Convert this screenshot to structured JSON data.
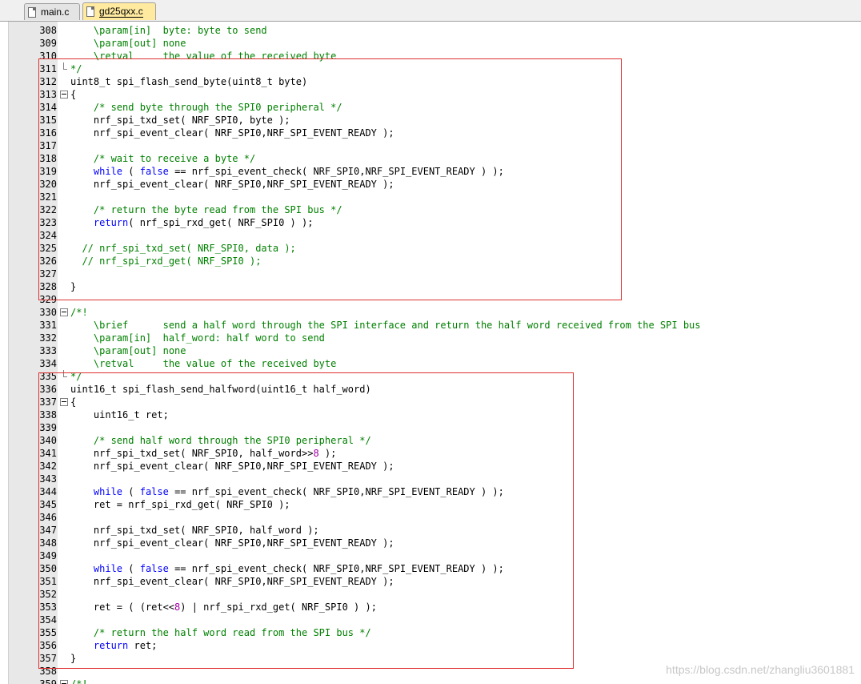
{
  "tabs": [
    {
      "label": "main.c",
      "active": false
    },
    {
      "label": "gd25qxx.c",
      "active": true
    }
  ],
  "colors": {
    "comment": "#008000",
    "keyword": "#0000ff",
    "number": "#a000a0",
    "highlight_box": "#e03030",
    "active_tab": "#ffeaa0"
  },
  "code_lines": [
    {
      "n": "308",
      "fold": "",
      "segs": [
        [
          "plain",
          "    "
        ],
        [
          "comment",
          "\\param[in]  byte: byte to send"
        ]
      ]
    },
    {
      "n": "309",
      "fold": "",
      "segs": [
        [
          "plain",
          "    "
        ],
        [
          "comment",
          "\\param[out] none"
        ]
      ]
    },
    {
      "n": "310",
      "fold": "",
      "segs": [
        [
          "plain",
          "    "
        ],
        [
          "comment",
          "\\retval     the value of the received byte"
        ]
      ]
    },
    {
      "n": "311",
      "fold": "end",
      "segs": [
        [
          "comment",
          "*/"
        ]
      ]
    },
    {
      "n": "312",
      "fold": "",
      "segs": [
        [
          "plain",
          "uint8_t spi_flash_send_byte(uint8_t byte)"
        ]
      ]
    },
    {
      "n": "313",
      "fold": "box",
      "segs": [
        [
          "plain",
          "{"
        ]
      ]
    },
    {
      "n": "314",
      "fold": "",
      "segs": [
        [
          "plain",
          "    "
        ],
        [
          "comment",
          "/* send byte through the SPI0 peripheral */"
        ]
      ]
    },
    {
      "n": "315",
      "fold": "",
      "segs": [
        [
          "plain",
          "    nrf_spi_txd_set( NRF_SPI0, byte );"
        ]
      ]
    },
    {
      "n": "316",
      "fold": "",
      "segs": [
        [
          "plain",
          "    nrf_spi_event_clear( NRF_SPI0,NRF_SPI_EVENT_READY );"
        ]
      ]
    },
    {
      "n": "317",
      "fold": "",
      "segs": []
    },
    {
      "n": "318",
      "fold": "",
      "segs": [
        [
          "plain",
          "    "
        ],
        [
          "comment",
          "/* wait to receive a byte */"
        ]
      ]
    },
    {
      "n": "319",
      "fold": "",
      "segs": [
        [
          "plain",
          "    "
        ],
        [
          "keyword",
          "while"
        ],
        [
          "plain",
          " ( "
        ],
        [
          "keyword",
          "false"
        ],
        [
          "plain",
          " == nrf_spi_event_check( NRF_SPI0,NRF_SPI_EVENT_READY ) );"
        ]
      ]
    },
    {
      "n": "320",
      "fold": "",
      "segs": [
        [
          "plain",
          "    nrf_spi_event_clear( NRF_SPI0,NRF_SPI_EVENT_READY );"
        ]
      ]
    },
    {
      "n": "321",
      "fold": "",
      "segs": []
    },
    {
      "n": "322",
      "fold": "",
      "segs": [
        [
          "plain",
          "    "
        ],
        [
          "comment",
          "/* return the byte read from the SPI bus */"
        ]
      ]
    },
    {
      "n": "323",
      "fold": "",
      "segs": [
        [
          "plain",
          "    "
        ],
        [
          "keyword",
          "return"
        ],
        [
          "plain",
          "( nrf_spi_rxd_get( NRF_SPI0 ) );"
        ]
      ]
    },
    {
      "n": "324",
      "fold": "",
      "segs": []
    },
    {
      "n": "325",
      "fold": "",
      "segs": [
        [
          "plain",
          "  "
        ],
        [
          "comment",
          "// nrf_spi_txd_set( NRF_SPI0, data );"
        ]
      ]
    },
    {
      "n": "326",
      "fold": "",
      "segs": [
        [
          "plain",
          "  "
        ],
        [
          "comment",
          "// nrf_spi_rxd_get( NRF_SPI0 );"
        ]
      ]
    },
    {
      "n": "327",
      "fold": "",
      "segs": []
    },
    {
      "n": "328",
      "fold": "",
      "segs": [
        [
          "plain",
          "}"
        ]
      ]
    },
    {
      "n": "329",
      "fold": "",
      "segs": []
    },
    {
      "n": "330",
      "fold": "box",
      "segs": [
        [
          "comment",
          "/*!"
        ]
      ]
    },
    {
      "n": "331",
      "fold": "",
      "segs": [
        [
          "plain",
          "    "
        ],
        [
          "comment",
          "\\brief      send a half word through the SPI interface and return the half word received from the SPI bus"
        ]
      ]
    },
    {
      "n": "332",
      "fold": "",
      "segs": [
        [
          "plain",
          "    "
        ],
        [
          "comment",
          "\\param[in]  half_word: half word to send"
        ]
      ]
    },
    {
      "n": "333",
      "fold": "",
      "segs": [
        [
          "plain",
          "    "
        ],
        [
          "comment",
          "\\param[out] none"
        ]
      ]
    },
    {
      "n": "334",
      "fold": "",
      "segs": [
        [
          "plain",
          "    "
        ],
        [
          "comment",
          "\\retval     the value of the received byte"
        ]
      ]
    },
    {
      "n": "335",
      "fold": "end",
      "segs": [
        [
          "comment",
          "*/"
        ]
      ]
    },
    {
      "n": "336",
      "fold": "",
      "segs": [
        [
          "plain",
          "uint16_t spi_flash_send_halfword(uint16_t half_word)"
        ]
      ]
    },
    {
      "n": "337",
      "fold": "box",
      "segs": [
        [
          "plain",
          "{"
        ]
      ]
    },
    {
      "n": "338",
      "fold": "",
      "segs": [
        [
          "plain",
          "    uint16_t ret;"
        ]
      ]
    },
    {
      "n": "339",
      "fold": "",
      "segs": []
    },
    {
      "n": "340",
      "fold": "",
      "segs": [
        [
          "plain",
          "    "
        ],
        [
          "comment",
          "/* send half word through the SPI0 peripheral */"
        ]
      ]
    },
    {
      "n": "341",
      "fold": "",
      "segs": [
        [
          "plain",
          "    nrf_spi_txd_set( NRF_SPI0, half_word>>"
        ],
        [
          "number",
          "8"
        ],
        [
          "plain",
          " );"
        ]
      ]
    },
    {
      "n": "342",
      "fold": "",
      "segs": [
        [
          "plain",
          "    nrf_spi_event_clear( NRF_SPI0,NRF_SPI_EVENT_READY );"
        ]
      ]
    },
    {
      "n": "343",
      "fold": "",
      "segs": []
    },
    {
      "n": "344",
      "fold": "",
      "segs": [
        [
          "plain",
          "    "
        ],
        [
          "keyword",
          "while"
        ],
        [
          "plain",
          " ( "
        ],
        [
          "keyword",
          "false"
        ],
        [
          "plain",
          " == nrf_spi_event_check( NRF_SPI0,NRF_SPI_EVENT_READY ) );"
        ]
      ]
    },
    {
      "n": "345",
      "fold": "",
      "segs": [
        [
          "plain",
          "    ret = nrf_spi_rxd_get( NRF_SPI0 );"
        ]
      ]
    },
    {
      "n": "346",
      "fold": "",
      "segs": []
    },
    {
      "n": "347",
      "fold": "",
      "segs": [
        [
          "plain",
          "    nrf_spi_txd_set( NRF_SPI0, half_word );"
        ]
      ]
    },
    {
      "n": "348",
      "fold": "",
      "segs": [
        [
          "plain",
          "    nrf_spi_event_clear( NRF_SPI0,NRF_SPI_EVENT_READY );"
        ]
      ]
    },
    {
      "n": "349",
      "fold": "",
      "segs": []
    },
    {
      "n": "350",
      "fold": "",
      "segs": [
        [
          "plain",
          "    "
        ],
        [
          "keyword",
          "while"
        ],
        [
          "plain",
          " ( "
        ],
        [
          "keyword",
          "false"
        ],
        [
          "plain",
          " == nrf_spi_event_check( NRF_SPI0,NRF_SPI_EVENT_READY ) );"
        ]
      ]
    },
    {
      "n": "351",
      "fold": "",
      "segs": [
        [
          "plain",
          "    nrf_spi_event_clear( NRF_SPI0,NRF_SPI_EVENT_READY );"
        ]
      ]
    },
    {
      "n": "352",
      "fold": "",
      "segs": []
    },
    {
      "n": "353",
      "fold": "",
      "segs": [
        [
          "plain",
          "    ret = ( (ret<<"
        ],
        [
          "number",
          "8"
        ],
        [
          "plain",
          ") | nrf_spi_rxd_get( NRF_SPI0 ) );"
        ]
      ]
    },
    {
      "n": "354",
      "fold": "",
      "segs": []
    },
    {
      "n": "355",
      "fold": "",
      "segs": [
        [
          "plain",
          "    "
        ],
        [
          "comment",
          "/* return the half word read from the SPI bus */"
        ]
      ]
    },
    {
      "n": "356",
      "fold": "",
      "segs": [
        [
          "plain",
          "    "
        ],
        [
          "keyword",
          "return"
        ],
        [
          "plain",
          " ret;"
        ]
      ]
    },
    {
      "n": "357",
      "fold": "",
      "segs": [
        [
          "plain",
          "}"
        ]
      ]
    },
    {
      "n": "358",
      "fold": "",
      "segs": []
    },
    {
      "n": "359",
      "fold": "box",
      "segs": [
        [
          "comment",
          "/*!"
        ]
      ]
    }
  ],
  "watermark": "https://blog.csdn.net/zhangliu3601881"
}
